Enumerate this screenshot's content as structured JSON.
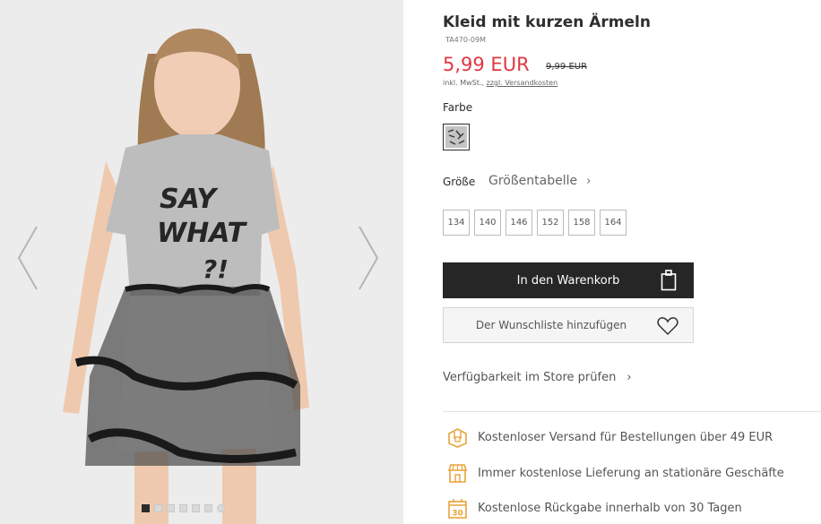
{
  "product": {
    "title": "Kleid mit kurzen Ärmeln",
    "sku": "TA470-09M",
    "price_new": "5,99 EUR",
    "price_old": "9,99 EUR",
    "tax_prefix": "inkl. MwSt.,",
    "tax_link": "zzgl. Versandkosten"
  },
  "color": {
    "label": "Farbe"
  },
  "size": {
    "label": "Größe",
    "chart_link": "Größentabelle",
    "options": [
      "134",
      "140",
      "146",
      "152",
      "158",
      "164"
    ]
  },
  "actions": {
    "cart_label": "In den Warenkorb",
    "wishlist_label": "Der Wunschliste hinzufügen",
    "store_check_label": "Verfügbarkeit im Store prüfen"
  },
  "benefits": [
    {
      "icon": "delivery-box-icon",
      "text": "Kostenloser Versand für Bestellungen über 49 EUR"
    },
    {
      "icon": "store-icon",
      "text": "Immer kostenlose Lieferung an stationäre Geschäfte"
    },
    {
      "icon": "calendar-30-icon",
      "text": "Kostenlose Rückgabe innerhalb von 30 Tagen"
    }
  ],
  "gallery": {
    "print_text": [
      "SAY",
      "WHAT",
      "?!"
    ],
    "slide_count": 7,
    "active_slide": 1
  },
  "colors": {
    "accent_price": "#e0373f",
    "cart_button": "#262626",
    "icon_orange": "#e8a33a"
  }
}
